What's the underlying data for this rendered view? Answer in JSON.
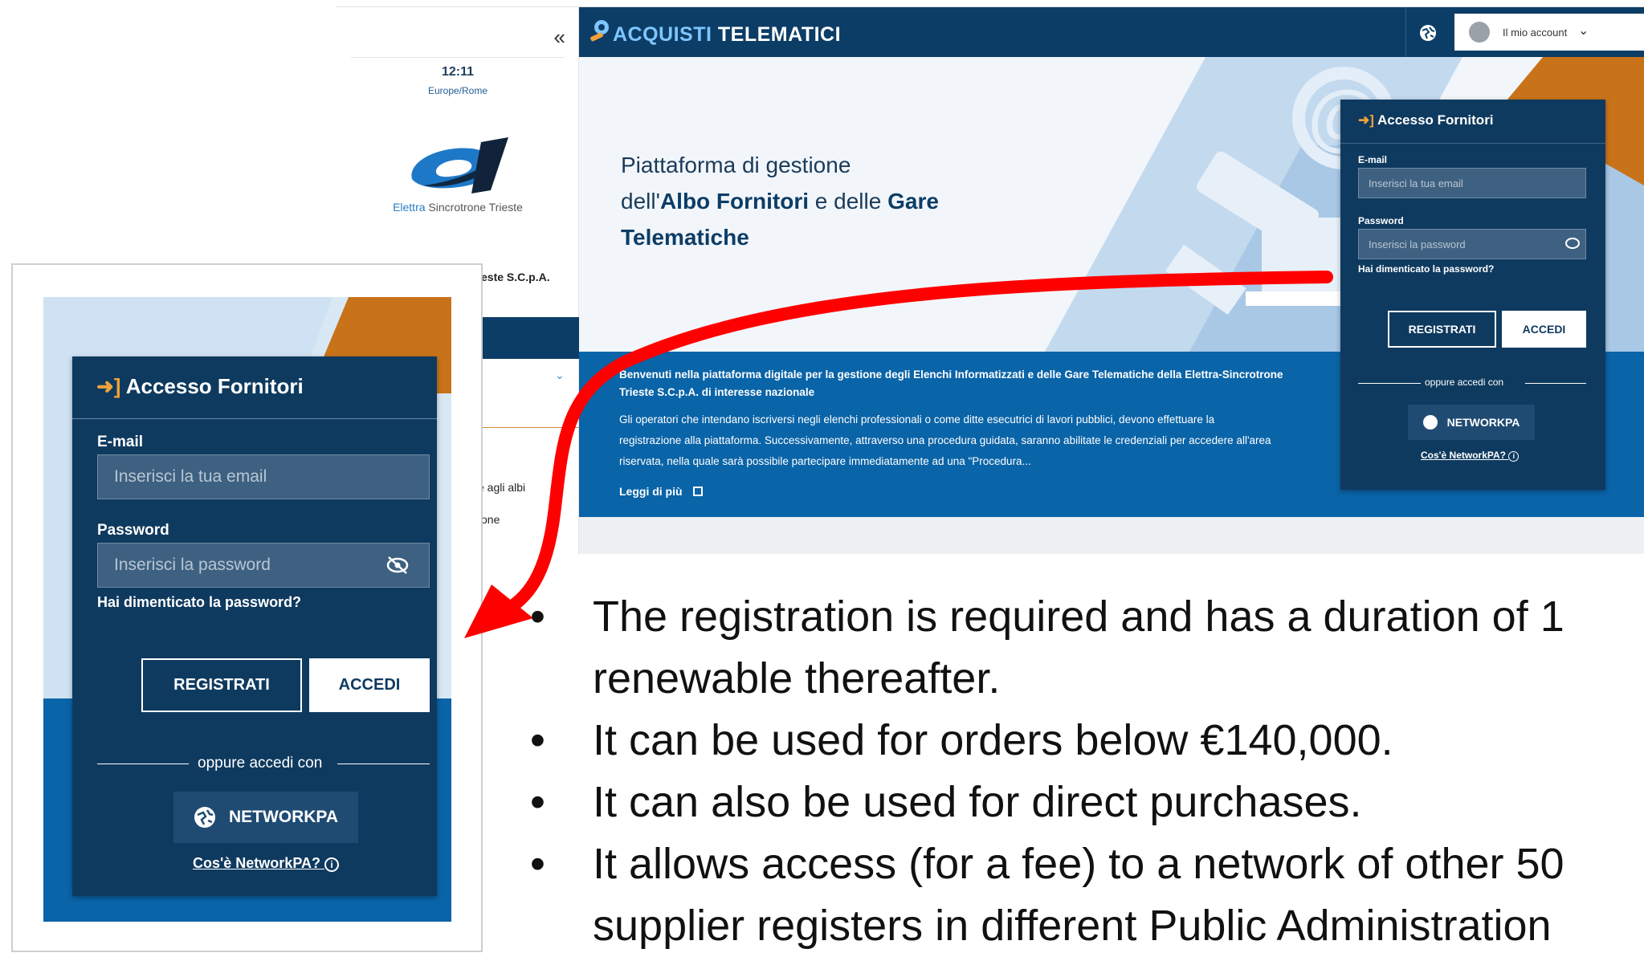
{
  "sidebar": {
    "collapse_icon": "«",
    "time": "12:11",
    "timezone": "Europe/Rome",
    "logo_caption_a": "Elettra",
    "logo_caption_b": " Sincrotrone Trieste",
    "company": "este S.C.p.A.",
    "text1": "e agli albi",
    "text2": "one"
  },
  "header": {
    "brand_a": "ACQUISTI",
    "brand_b": " TELEMATICI",
    "account_label": "Il mio account"
  },
  "hero": {
    "line1": "Piattaforma di gestione",
    "line2_a": "dell'",
    "line2_b": "Albo Fornitori",
    "line2_c": " e delle ",
    "line2_d": "Gare",
    "line3": "Telematiche"
  },
  "band": {
    "bold_text": "Benvenuti nella piattaforma digitale per la gestione degli Elenchi Informatizzati e delle Gare Telematiche della Elettra-Sincrotrone Trieste S.C.p.A. di interesse nazionale",
    "body_text": "Gli operatori che intendano iscriversi negli elenchi professionali o come ditte esecutrici di lavori pubblici, devono effettuare la registrazione alla piattaforma. Successivamente, attraverso una procedura guidata, saranno abilitate le credenziali per accedere all'area riservata, nella quale sarà possibile partecipare immediatamente ad una \"Procedura...",
    "read_more": "Leggi di più"
  },
  "login": {
    "title": "Accesso Fornitori",
    "email_label": "E-mail",
    "email_placeholder": "Inserisci la tua email",
    "password_label": "Password",
    "password_placeholder": "Inserisci la password",
    "forgot": "Hai dimenticato la password?",
    "register": "REGISTRATI",
    "login": "ACCEDI",
    "or": "oppure accedi con",
    "networkpa": "NETWORKPA",
    "what_is": "Cos'è NetworkPA?"
  },
  "bullets": {
    "b1a": "The registration is required and has a duration of 1",
    "b1b": "renewable thereafter.",
    "b2": "It can be used for orders below €140,000.",
    "b3": "It can also be used for direct purchases.",
    "b4a": "It allows access (for a fee) to a network of other 50",
    "b4b": "supplier registers in different Public Administration"
  },
  "colors": {
    "navy": "#0f3a5f",
    "header_blue": "#0c3d66",
    "band_blue": "#0a64a8",
    "accent_orange": "#c8731a",
    "arrow_red": "#ff0000"
  }
}
